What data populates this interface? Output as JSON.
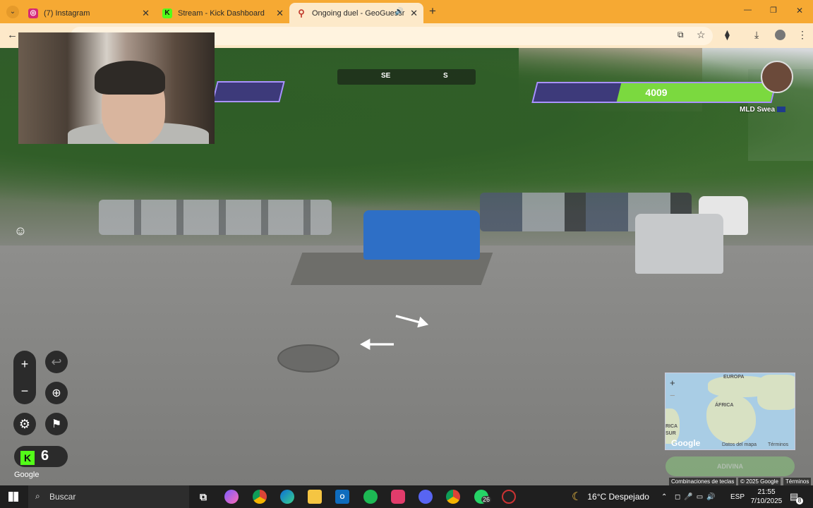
{
  "browser": {
    "tabs": [
      {
        "label": "(7) Instagram",
        "icon": "instagram-icon",
        "color": "#d62976"
      },
      {
        "label": "Stream - Kick Dashboard",
        "icon": "kick-icon",
        "color": "#53fc18"
      },
      {
        "label": "Ongoing duel - GeoGuessr",
        "icon": "location-pin-icon",
        "color": "#c0392b"
      }
    ],
    "new_tab": "+",
    "window_controls": {
      "minimize": "—",
      "restore": "❐",
      "close": "✕"
    }
  },
  "hud": {
    "compass_labels": [
      "SE",
      "S"
    ],
    "opponent_health": "4009",
    "opponent_health_fraction": 0.65,
    "opponent_name": "MLD Swea"
  },
  "controls": {
    "zoom_in": "+",
    "zoom_out": "−",
    "undo": "↩",
    "emoji": "☺"
  },
  "kick": {
    "count": "6",
    "letter": "K"
  },
  "google_label": "Google",
  "minimap": {
    "labels": [
      "EUROPA",
      "ÁFRICA",
      "RICA",
      "SUR"
    ],
    "google": "Google",
    "footer_keyboard": "Datos del mapa",
    "footer_terms": "Términos",
    "zoom": "+",
    "zoom_out": "−"
  },
  "guess_button": "ADIVINA",
  "attribution": {
    "shortcuts": "Combinaciones de teclas",
    "copyright": "© 2025 Google",
    "terms": "Términos"
  },
  "taskbar": {
    "search_placeholder": "Buscar",
    "weather": "16°C  Despejado",
    "language": "ESP",
    "time": "21:55",
    "date": "7/10/2025",
    "whatsapp_badge": "26",
    "notifications": "8"
  },
  "colors": {
    "tabbar": "#f6a933",
    "health_fill": "#7bd93f",
    "health_frame": "#a992ff",
    "kick_green": "#53fc18"
  }
}
